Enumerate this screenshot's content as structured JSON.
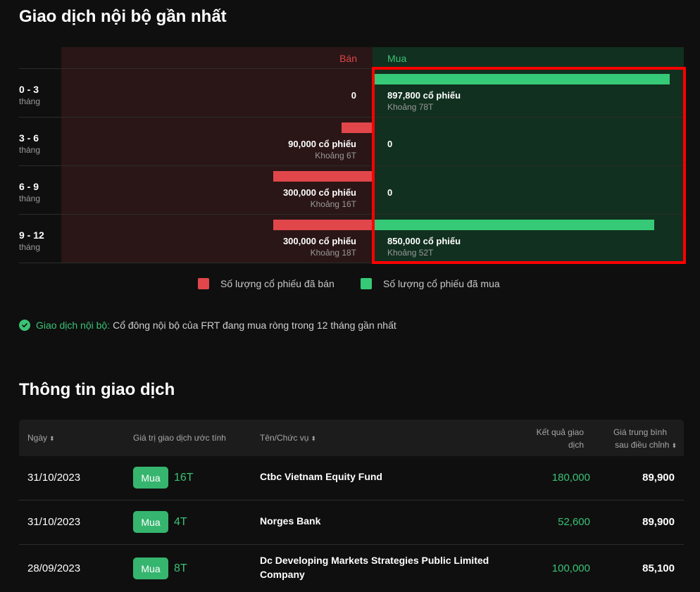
{
  "section1": {
    "title": "Giao dịch nội bộ gần nhất",
    "header_sell": "Bán",
    "header_buy": "Mua",
    "rows": [
      {
        "range": "0 - 3",
        "unit": "tháng",
        "sell_main": "0",
        "sell_sub": "",
        "buy_main": "897,800 cổ phiếu",
        "buy_sub": "Khoảng 78T",
        "sell_fraction": 0,
        "buy_fraction": 0.95
      },
      {
        "range": "3 - 6",
        "unit": "tháng",
        "sell_main": "90,000 cổ phiếu",
        "sell_sub": "Khoảng 6T",
        "buy_main": "0",
        "buy_sub": "",
        "sell_fraction": 0.1,
        "buy_fraction": 0
      },
      {
        "range": "6 - 9",
        "unit": "tháng",
        "sell_main": "300,000 cổ phiếu",
        "sell_sub": "Khoảng 16T",
        "buy_main": "0",
        "buy_sub": "",
        "sell_fraction": 0.32,
        "buy_fraction": 0
      },
      {
        "range": "9 - 12",
        "unit": "tháng",
        "sell_main": "300,000 cổ phiếu",
        "sell_sub": "Khoảng 18T",
        "buy_main": "850,000 cổ phiếu",
        "buy_sub": "Khoảng 52T",
        "sell_fraction": 0.32,
        "buy_fraction": 0.9
      }
    ],
    "legend_sell": "Số lượng cổ phiếu đã bán",
    "legend_buy": "Số lượng cổ phiếu đã mua",
    "note_lead": "Giao dịch nội bộ:",
    "note_text": "Cổ đông nội bộ của FRT đang mua ròng trong 12 tháng gần nhất",
    "colors": {
      "sell": "#e0464a",
      "buy": "#36c977",
      "highlight": "#ff0000"
    }
  },
  "section2": {
    "title": "Thông tin giao dịch",
    "headers": {
      "date": "Ngày",
      "value": "Giá trị giao dịch ước tính",
      "name": "Tên/Chức vụ",
      "result_line1": "Kết quả giao",
      "result_line2": "dịch",
      "price_line1": "Giá trung bình",
      "price_line2": "sau điều chỉnh"
    },
    "rows": [
      {
        "date": "31/10/2023",
        "action": "Mua",
        "amount": "16T",
        "name": "Ctbc Vietnam Equity Fund",
        "result": "180,000",
        "price": "89,900"
      },
      {
        "date": "31/10/2023",
        "action": "Mua",
        "amount": "4T",
        "name": "Norges Bank",
        "result": "52,600",
        "price": "89,900"
      },
      {
        "date": "28/09/2023",
        "action": "Mua",
        "amount": "8T",
        "name": "Dc Developing Markets Strategies Public Limited Company",
        "result": "100,000",
        "price": "85,100"
      }
    ]
  }
}
